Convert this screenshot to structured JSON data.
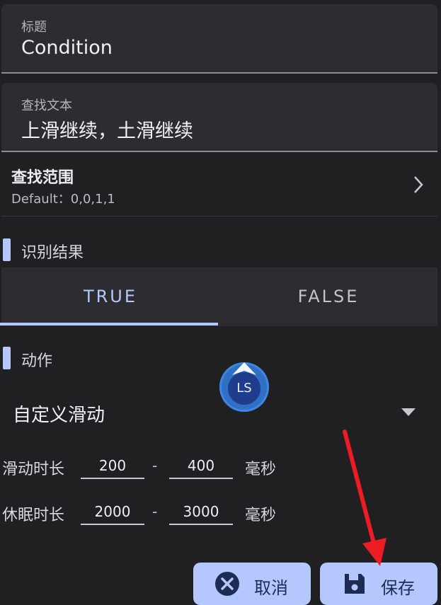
{
  "title_field": {
    "label": "标题",
    "value": "Condition"
  },
  "search_text_field": {
    "label": "查找文本",
    "value": "上滑继续，土滑继续"
  },
  "search_range": {
    "title": "查找范围",
    "subtitle": "Default：0,0,1,1"
  },
  "recognition_result": {
    "section_title": "识别结果",
    "tabs": [
      {
        "label": "TRUE",
        "selected": true
      },
      {
        "label": "FALSE",
        "selected": false
      }
    ]
  },
  "action": {
    "section_title": "动作",
    "dropdown_value": "自定义滑动",
    "overlay_badge": "LS"
  },
  "slide_duration": {
    "label": "滑动时长",
    "min": "200",
    "separator": "-",
    "max": "400",
    "unit": "毫秒"
  },
  "sleep_duration": {
    "label": "休眠时长",
    "min": "2000",
    "separator": "-",
    "max": "3000",
    "unit": "毫秒"
  },
  "buttons": {
    "cancel": "取消",
    "save": "保存"
  },
  "colors": {
    "background": "#201f22",
    "accent": "#b5c7ff",
    "annotation_arrow": "#ec1c24"
  }
}
